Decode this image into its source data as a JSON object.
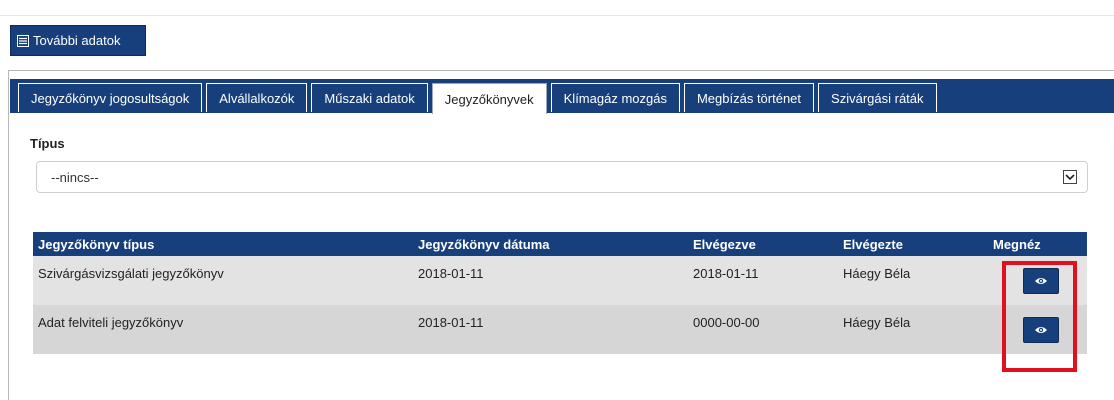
{
  "toolbar": {
    "more_data_label": "További adatok",
    "more_data_icon": "list-icon"
  },
  "tabs": [
    {
      "label": "Jegyzőkönyv jogosultságok",
      "active": false
    },
    {
      "label": "Alvállalkozók",
      "active": false
    },
    {
      "label": "Műszaki adatok",
      "active": false
    },
    {
      "label": "Jegyzőkönyvek",
      "active": true
    },
    {
      "label": "Klímagáz mozgás",
      "active": false
    },
    {
      "label": "Megbízás történet",
      "active": false
    },
    {
      "label": "Szivárgási ráták",
      "active": false
    }
  ],
  "filter": {
    "label": "Típus",
    "selected": "--nincs--"
  },
  "table": {
    "headers": [
      "Jegyzőkönyv típus",
      "Jegyzőkönyv dátuma",
      "Elvégezve",
      "Elvégezte",
      "Megnéz"
    ],
    "rows": [
      {
        "type": "Szivárgásvizsgálati jegyzőkönyv",
        "date": "2018-01-11",
        "done": "2018-01-11",
        "by": "Háegy Béla",
        "view_icon": "eye-icon"
      },
      {
        "type": "Adat felviteli jegyzőkönyv",
        "date": "2018-01-11",
        "done": "0000-00-00",
        "by": "Háegy Béla",
        "view_icon": "eye-icon"
      }
    ]
  },
  "colors": {
    "primary": "#173f7c",
    "highlight": "#e0101e",
    "row_odd": "#e3e3e3",
    "row_even": "#d6d6d6"
  }
}
